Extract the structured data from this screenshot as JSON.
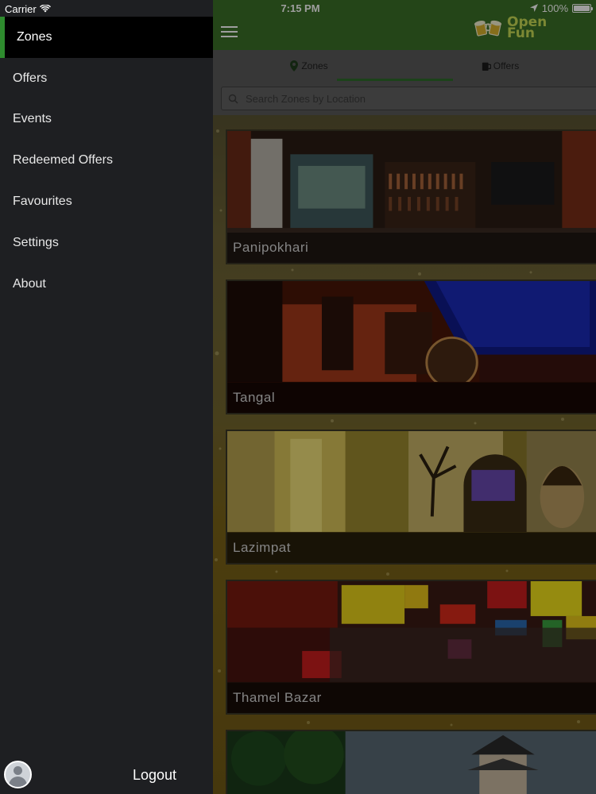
{
  "status_bar": {
    "carrier": "Carrier",
    "time": "7:15 PM",
    "battery": "100%"
  },
  "sidebar": {
    "items": [
      {
        "label": "Zones",
        "active": true
      },
      {
        "label": "Offers",
        "active": false
      },
      {
        "label": "Events",
        "active": false
      },
      {
        "label": "Redeemed Offers",
        "active": false
      },
      {
        "label": "Favourites",
        "active": false
      },
      {
        "label": "Settings",
        "active": false
      },
      {
        "label": "About",
        "active": false
      }
    ],
    "logout_label": "Logout"
  },
  "header": {
    "logo_line1": "Open",
    "logo_line2": "Fun"
  },
  "tabs": [
    {
      "label": "Zones",
      "icon": "map-pin-icon",
      "active": true
    },
    {
      "label": "Offers",
      "icon": "beer-mug-icon",
      "active": false
    }
  ],
  "search": {
    "placeholder": "Search Zones by Location",
    "value": ""
  },
  "zones": [
    {
      "name": "Panipokhari"
    },
    {
      "name": "Tangal"
    },
    {
      "name": "Lazimpat"
    },
    {
      "name": "Thamel Bazar"
    },
    {
      "name": ""
    }
  ],
  "colors": {
    "accent_green": "#2e8b2e",
    "header_green": "#3b7027",
    "sidebar_bg": "#1e1f22",
    "logo_text": "#c9dc55"
  }
}
